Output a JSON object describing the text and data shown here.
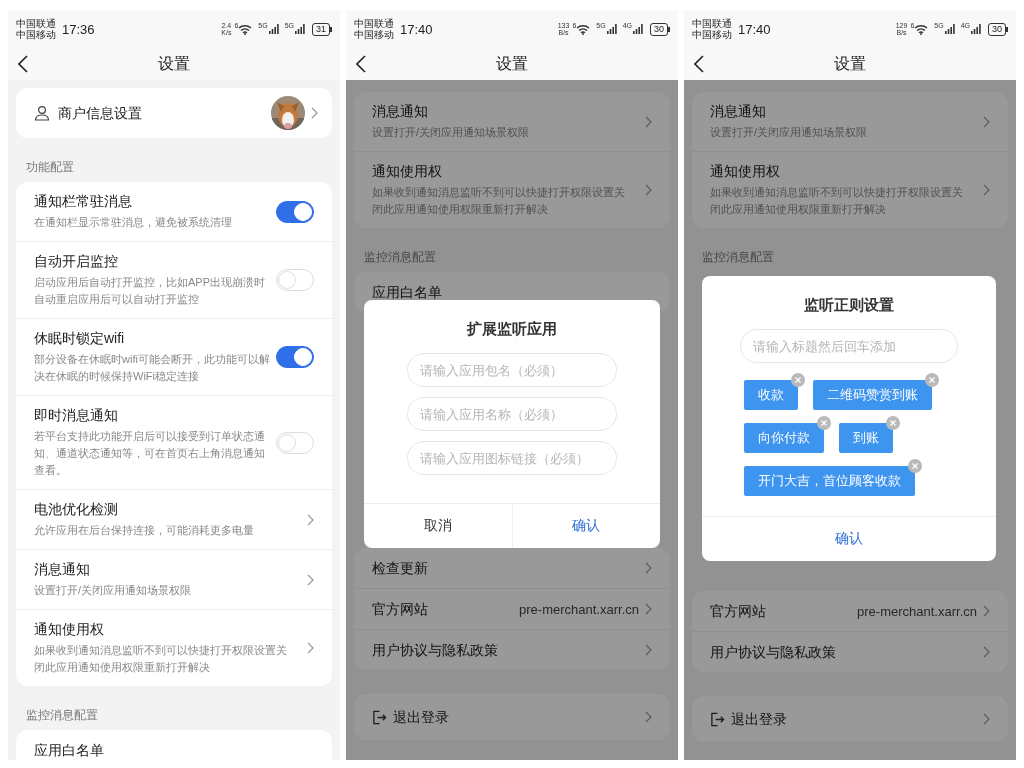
{
  "screens": [
    {
      "status_bar": {
        "carriers": [
          "中国联通",
          "中国移动"
        ],
        "time": "17:36",
        "speed_value": "2.4",
        "speed_unit": "K/s",
        "wifi_badge": "6",
        "networks": [
          "5G",
          "5G"
        ],
        "battery": "31"
      },
      "nav": {
        "title": "设置"
      },
      "blocks": [
        {
          "kind": "card",
          "rows": [
            {
              "kind": "profile",
              "title": "商户信息设置"
            }
          ]
        },
        {
          "kind": "heading",
          "text": "功能配置"
        },
        {
          "kind": "card",
          "rows": [
            {
              "kind": "toggle",
              "title": "通知栏常驻消息",
              "desc": "在通知栏显示常驻消息，避免被系统清理",
              "on": true
            },
            {
              "kind": "toggle",
              "title": "自动开启监控",
              "desc": "启动应用后自动打开监控，比如APP出现崩溃时自动重启应用后可以自动打开监控",
              "on": false
            },
            {
              "kind": "toggle",
              "title": "休眠时锁定wifi",
              "desc": "部分设备在休眠时wifi可能会断开，此功能可以解决在休眠的时候保持WiFi稳定连接",
              "on": true
            },
            {
              "kind": "toggle",
              "title": "即时消息通知",
              "desc": "若平台支持此功能开启后可以接受到订单状态通知、通道状态通知等，可在首页右上角消息通知查看。",
              "on": false
            },
            {
              "kind": "link",
              "title": "电池优化检测",
              "desc": "允许应用在后台保持连接，可能消耗更多电量"
            },
            {
              "kind": "link",
              "title": "消息通知",
              "desc": "设置打开/关闭应用通知场景权限"
            },
            {
              "kind": "link",
              "title": "通知使用权",
              "desc": "如果收到通知消息监听不到可以快捷打开权限设置关闭此应用通知使用权限重新打开解决"
            }
          ]
        },
        {
          "kind": "heading",
          "text": "监控消息配置"
        },
        {
          "kind": "card",
          "rows": [
            {
              "kind": "plain",
              "title": "应用白名单"
            }
          ]
        }
      ]
    },
    {
      "status_bar": {
        "carriers": [
          "中国联通",
          "中国移动"
        ],
        "time": "17:40",
        "speed_value": "133",
        "speed_unit": "B/s",
        "wifi_badge": "6",
        "networks": [
          "5G",
          "4G"
        ],
        "battery": "30"
      },
      "nav": {
        "title": "设置"
      },
      "blocks": [
        {
          "kind": "card",
          "rows": [
            {
              "kind": "link",
              "title": "消息通知",
              "desc": "设置打开/关闭应用通知场景权限"
            },
            {
              "kind": "link",
              "title": "通知使用权",
              "desc": "如果收到通知消息监听不到可以快捷打开权限设置关闭此应用通知使用权限重新打开解决"
            }
          ]
        },
        {
          "kind": "heading",
          "text": "监控消息配置"
        },
        {
          "kind": "card",
          "rows": [
            {
              "kind": "plain",
              "title": "应用白名单"
            }
          ]
        },
        {
          "kind": "dialog",
          "title": "扩展监听应用",
          "fields": [
            {
              "placeholder": "请输入应用包名（必须）"
            },
            {
              "placeholder": "请输入应用名称（必须）"
            },
            {
              "placeholder": "请输入应用图标链接（必须）"
            }
          ],
          "buttons": [
            {
              "label": "取消",
              "kind": "cancel"
            },
            {
              "label": "确认",
              "kind": "primary"
            }
          ]
        },
        {
          "kind": "card",
          "rows": [
            {
              "kind": "link",
              "title": "检查更新"
            },
            {
              "kind": "link",
              "title": "官方网站",
              "value": "pre-merchant.xarr.cn"
            },
            {
              "kind": "link",
              "title": "用户协议与隐私政策"
            }
          ]
        },
        {
          "kind": "card",
          "rows": [
            {
              "kind": "logout",
              "title": "退出登录"
            }
          ]
        }
      ]
    },
    {
      "status_bar": {
        "carriers": [
          "中国联通",
          "中国移动"
        ],
        "time": "17:40",
        "speed_value": "129",
        "speed_unit": "B/s",
        "wifi_badge": "6",
        "networks": [
          "5G",
          "4G"
        ],
        "battery": "30"
      },
      "nav": {
        "title": "设置"
      },
      "blocks": [
        {
          "kind": "card",
          "rows": [
            {
              "kind": "link",
              "title": "消息通知",
              "desc": "设置打开/关闭应用通知场景权限"
            },
            {
              "kind": "link",
              "title": "通知使用权",
              "desc": "如果收到通知消息监听不到可以快捷打开权限设置关闭此应用通知使用权限重新打开解决"
            }
          ]
        },
        {
          "kind": "heading",
          "text": "监控消息配置"
        },
        {
          "kind": "dialog",
          "title": "监听正则设置",
          "fields": [
            {
              "placeholder": "请输入标题然后回车添加"
            }
          ],
          "tags": [
            "收款",
            "二维码赞赏到账",
            "向你付款",
            "到账",
            "开门大吉，首位顾客收款"
          ],
          "buttons": [
            {
              "label": "确认",
              "kind": "primary"
            }
          ]
        },
        {
          "kind": "card",
          "rows": [
            {
              "kind": "link",
              "title": "官方网站",
              "value": "pre-merchant.xarr.cn"
            },
            {
              "kind": "link",
              "title": "用户协议与隐私政策"
            }
          ]
        },
        {
          "kind": "card",
          "rows": [
            {
              "kind": "logout",
              "title": "退出登录"
            }
          ]
        }
      ]
    }
  ]
}
